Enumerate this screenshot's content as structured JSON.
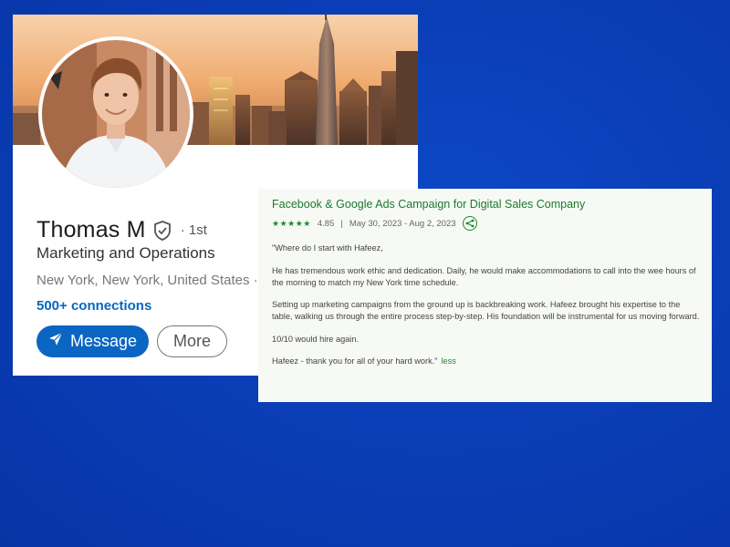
{
  "profile": {
    "name": "Thomas M",
    "degree": "· 1st",
    "headline": "Marketing and Operations",
    "location": "New York, New York, United States ·",
    "connections": "500+ connections",
    "message_label": "Message",
    "more_label": "More",
    "accent_color": "#0a66c2"
  },
  "review": {
    "title": "Facebook & Google Ads Campaign for Digital Sales Company",
    "stars": "★★★★★",
    "rating": "4.85",
    "separator": "|",
    "dates": "May 30, 2023 - Aug 2, 2023",
    "paragraphs": [
      "\"Where do I start with Hafeez,",
      "He has tremendous work ethic and dedication. Daily, he would make accommodations to call into the wee hours of the morning to match my New York time schedule.",
      "Setting up marketing campaigns from the ground up is backbreaking work. Hafeez brought his expertise to the table, walking us through the entire process step-by-step. His foundation will be instrumental for us moving forward.",
      "10/10 would hire again.",
      "Hafeez - thank you for all of your hard work.\""
    ],
    "less_label": "less",
    "accent_color": "#1a8a2e"
  }
}
